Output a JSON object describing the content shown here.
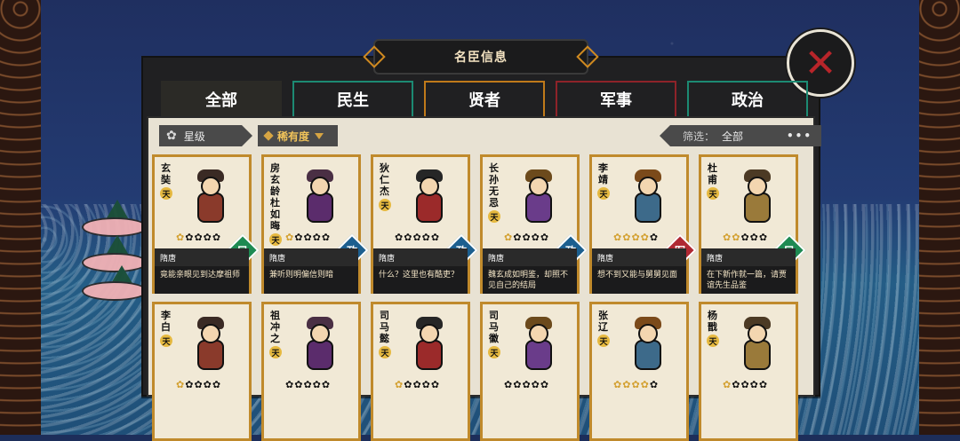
{
  "header": {
    "title": "名臣信息"
  },
  "tabs": [
    {
      "label": "全部"
    },
    {
      "label": "民生"
    },
    {
      "label": "贤者"
    },
    {
      "label": "军事"
    },
    {
      "label": "政治"
    }
  ],
  "filters": {
    "left_label": "星级",
    "mid_label": "稀有度",
    "right_prefix": "筛选：",
    "right_value": "全部",
    "more_label": "•••"
  },
  "cards": [
    {
      "name": "玄奘",
      "tier": "天",
      "dynasty": "隋唐",
      "type": "民",
      "type_color": "min",
      "stars_on": 1,
      "stars_total": 5,
      "quote": "竟能亲眼见到达摩祖师"
    },
    {
      "name": "房玄龄杜如晦",
      "tier": "天",
      "dynasty": "隋唐",
      "type": "政",
      "type_color": "zheng",
      "stars_on": 1,
      "stars_total": 5,
      "quote": "兼听则明偏信则暗"
    },
    {
      "name": "狄仁杰",
      "tier": "天",
      "dynasty": "隋唐",
      "type": "政",
      "type_color": "zheng",
      "stars_on": 0,
      "stars_total": 5,
      "quote": "什么？这里也有酷吏？"
    },
    {
      "name": "长孙无忌",
      "tier": "天",
      "dynasty": "隋唐",
      "type": "政",
      "type_color": "zheng",
      "stars_on": 1,
      "stars_total": 5,
      "quote": "魏玄成如明鉴，却照不见自己的结局"
    },
    {
      "name": "李靖",
      "tier": "天",
      "dynasty": "隋唐",
      "type": "军",
      "type_color": "jun",
      "stars_on": 4,
      "stars_total": 5,
      "quote": "想不到又能与舅舅见面"
    },
    {
      "name": "杜甫",
      "tier": "天",
      "dynasty": "隋唐",
      "type": "民",
      "type_color": "min",
      "stars_on": 2,
      "stars_total": 5,
      "quote": "在下新作就一篇，请贾谊先生品鉴"
    },
    {
      "name": "李白",
      "tier": "天",
      "dynasty": "",
      "type": "",
      "type_color": "min",
      "stars_on": 1,
      "stars_total": 5,
      "quote": ""
    },
    {
      "name": "祖冲之",
      "tier": "天",
      "dynasty": "",
      "type": "",
      "type_color": "min",
      "stars_on": 0,
      "stars_total": 5,
      "quote": ""
    },
    {
      "name": "司马懿",
      "tier": "天",
      "dynasty": "",
      "type": "",
      "type_color": "zheng",
      "stars_on": 1,
      "stars_total": 5,
      "quote": ""
    },
    {
      "name": "司马徽",
      "tier": "天",
      "dynasty": "",
      "type": "",
      "type_color": "min",
      "stars_on": 0,
      "stars_total": 5,
      "quote": ""
    },
    {
      "name": "张辽",
      "tier": "天",
      "dynasty": "",
      "type": "",
      "type_color": "jun",
      "stars_on": 4,
      "stars_total": 5,
      "quote": ""
    },
    {
      "name": "杨戬",
      "tier": "天",
      "dynasty": "",
      "type": "",
      "type_color": "min",
      "stars_on": 1,
      "stars_total": 5,
      "quote": ""
    }
  ],
  "colors": {
    "tab_min": "#1c8a73",
    "tab_xian": "#c07a1a",
    "tab_jun": "#8e2329",
    "tab_zheng": "#1c8a73",
    "card_border": "#c08a2c"
  },
  "icons": {
    "close": "close-icon",
    "star_filter": "star-icon",
    "dropdown": "chevron-down-icon"
  }
}
